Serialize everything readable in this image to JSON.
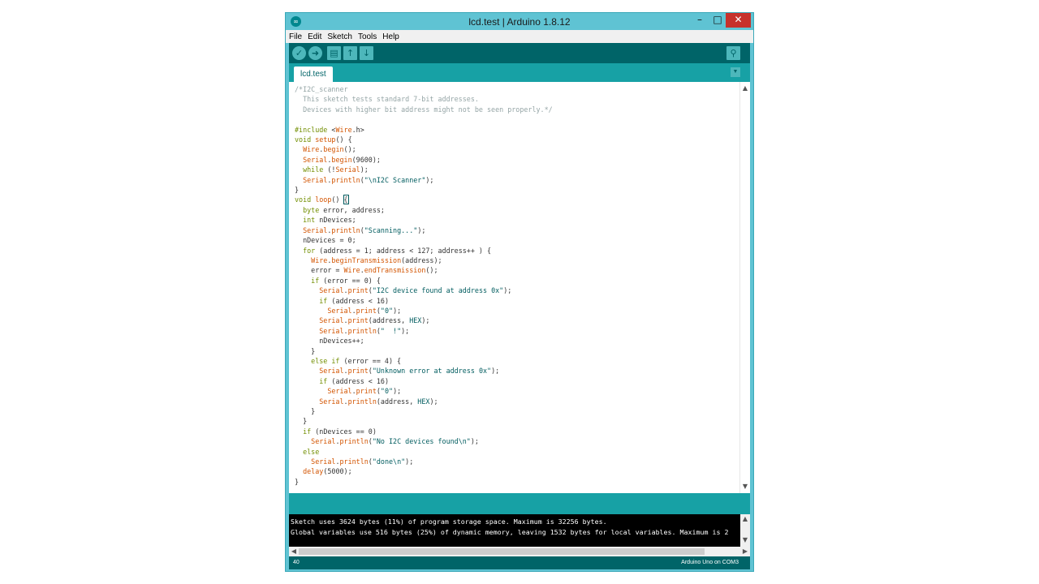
{
  "window": {
    "title": "lcd.test | Arduino 1.8.12",
    "app_icon": "arduino-logo-icon",
    "controls": {
      "minimize": "–",
      "maximize": "□",
      "close": "✕"
    }
  },
  "menubar": {
    "items": [
      "File",
      "Edit",
      "Sketch",
      "Tools",
      "Help"
    ]
  },
  "toolbar": {
    "buttons": [
      {
        "name": "verify-button",
        "icon": "check-icon",
        "glyph": "✓"
      },
      {
        "name": "upload-button",
        "icon": "arrow-right-icon",
        "glyph": "➜"
      },
      {
        "name": "new-button",
        "icon": "new-file-icon",
        "glyph": "▤"
      },
      {
        "name": "open-button",
        "icon": "arrow-up-icon",
        "glyph": "↑"
      },
      {
        "name": "save-button",
        "icon": "arrow-down-icon",
        "glyph": "↓"
      }
    ],
    "serial_monitor_icon": "magnifier-icon",
    "serial_monitor_glyph": "⚲"
  },
  "tabs": {
    "active": "lcd.test",
    "menu_glyph": "▼"
  },
  "editor": {
    "lines": [
      "/*I2C_scanner",
      "  This sketch tests standard 7-bit addresses.",
      "  Devices with higher bit address might not be seen properly.*/",
      "",
      "#include <Wire.h>",
      "void setup() {",
      "  Wire.begin();",
      "  Serial.begin(9600);",
      "  while (!Serial);",
      "  Serial.println(\"\\nI2C Scanner\");",
      "}",
      "void loop() {",
      "  byte error, address;",
      "  int nDevices;",
      "  Serial.println(\"Scanning...\");",
      "  nDevices = 0;",
      "  for (address = 1; address < 127; address++ ) {",
      "    Wire.beginTransmission(address);",
      "    error = Wire.endTransmission();",
      "    if (error == 0) {",
      "      Serial.print(\"I2C device found at address 0x\");",
      "      if (address < 16)",
      "        Serial.print(\"0\");",
      "      Serial.print(address, HEX);",
      "      Serial.println(\"  !\");",
      "      nDevices++;",
      "    }",
      "    else if (error == 4) {",
      "      Serial.print(\"Unknown error at address 0x\");",
      "      if (address < 16)",
      "        Serial.print(\"0\");",
      "      Serial.println(address, HEX);",
      "    }",
      "  }",
      "  if (nDevices == 0)",
      "    Serial.println(\"No I2C devices found\\n\");",
      "  else",
      "    Serial.println(\"done\\n\");",
      "  delay(5000);",
      "}"
    ]
  },
  "console": {
    "lines": [
      "Sketch uses 3624 bytes (11%) of program storage space. Maximum is 32256 bytes.",
      "Global variables use 516 bytes (25%) of dynamic memory, leaving 1532 bytes for local variables. Maximum is 2"
    ]
  },
  "footer": {
    "line_number": "40",
    "board": "Arduino Uno on COM3"
  }
}
